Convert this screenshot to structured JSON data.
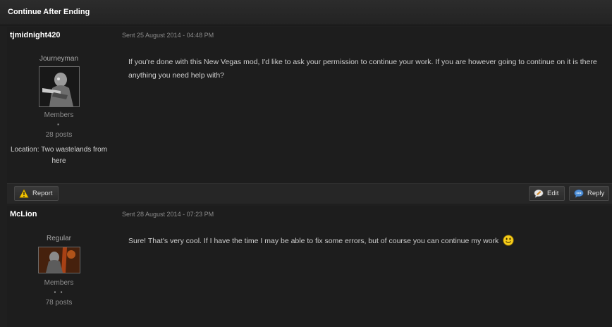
{
  "topic": {
    "title": "Continue After Ending"
  },
  "posts": [
    {
      "author": "tjmidnight420",
      "date": "Sent 25 August 2014 - 04:48 PM",
      "rank": "Journeyman",
      "group": "Members",
      "pips": "▪",
      "posts_count": "28 posts",
      "location": "Location: Two wastelands from here",
      "message": "If you're done with this New Vegas mod, I'd like to ask your permission to continue your work. If you are however going to continue on it is there anything you need help with?",
      "actions": {
        "report": "Report",
        "edit": "Edit",
        "reply": "Reply"
      }
    },
    {
      "author": "McLion",
      "date": "Sent 28 August 2014 - 07:23 PM",
      "rank": "Regular",
      "group": "Members",
      "pips": "▪ ▪",
      "posts_count": "78 posts",
      "message": "Sure! That's very cool. If I have the time I may be able to fix some errors, but of course you can continue my work"
    }
  ],
  "icons": {
    "report": "warning-icon",
    "edit": "edit-speech-icon",
    "reply": "reply-speech-icon",
    "smiley": "smiley-icon"
  },
  "colors": {
    "background": "#1f1f1f",
    "title_text": "#ffffff",
    "warning_yellow": "#f2c200",
    "reply_blue": "#4f8fd6"
  }
}
